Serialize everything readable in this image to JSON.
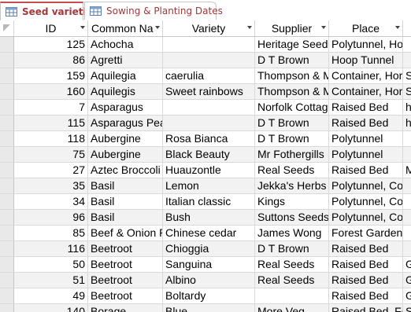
{
  "tabs": [
    {
      "label": "Seed varieties",
      "active": true
    },
    {
      "label": "Sowing & Planting Dates",
      "active": false
    }
  ],
  "columns": [
    "ID",
    "Common Na",
    "Variety",
    "Supplier",
    "Place",
    ""
  ],
  "rows": [
    [
      "125",
      "Achocha",
      "",
      "Heritage Seed",
      "Polytunnel, Ho",
      ""
    ],
    [
      "86",
      "Agretti",
      "",
      "D T Brown",
      "Hoop Tunnel",
      ""
    ],
    [
      "159",
      "Aquilegia",
      "caerulia",
      "Thompson & M",
      "Container, Hor",
      "S"
    ],
    [
      "160",
      "Aquilegis",
      "Sweet rainbows",
      "Thompson & M",
      "Container, Hor",
      "S"
    ],
    [
      "7",
      "Asparagus",
      "",
      "Norfolk Cottag",
      "Raised Bed",
      "h"
    ],
    [
      "115",
      "Asparagus Pea",
      "",
      "D T Brown",
      "Raised Bed",
      "h"
    ],
    [
      "118",
      "Aubergine",
      "Rosa Bianca",
      "D T Brown",
      "Polytunnel",
      ""
    ],
    [
      "75",
      "Aubergine",
      "Black Beauty",
      "Mr Fothergills",
      "Polytunnel",
      ""
    ],
    [
      "27",
      "Aztec Broccoli",
      "Huauzontle",
      "Real Seeds",
      "Raised Bed",
      "M"
    ],
    [
      "35",
      "Basil",
      "Lemon",
      "Jekka's Herbs",
      "Polytunnel, Co",
      ""
    ],
    [
      "34",
      "Basil",
      "Italian classic",
      "Kings",
      "Polytunnel, Co",
      ""
    ],
    [
      "96",
      "Basil",
      "Bush",
      "Suttons Seeds",
      "Polytunnel, Co",
      ""
    ],
    [
      "85",
      "Beef & Onion P",
      "Chinese cedar",
      "James Wong",
      "Forest Garden",
      ""
    ],
    [
      "116",
      "Beetroot",
      "Chioggia",
      "D T Brown",
      "Raised Bed",
      ""
    ],
    [
      "50",
      "Beetroot",
      "Sanguina",
      "Real Seeds",
      "Raised Bed",
      "G"
    ],
    [
      "51",
      "Beetroot",
      "Albino",
      "Real Seeds",
      "Raised Bed",
      "G"
    ],
    [
      "49",
      "Beetroot",
      "Boltardy",
      "",
      "Raised Bed",
      "G"
    ],
    [
      "140",
      "Borage",
      "Blue",
      "More Veg",
      "Raised Bed, Fo",
      "S"
    ]
  ],
  "icons": {
    "tab": "table-icon",
    "sort": "dropdown-arrow-icon",
    "select_all": "select-all-icon"
  },
  "colors": {
    "tab_text": "#a4373a",
    "active_tab_border": "#c0504d",
    "alt_row": "#f2f2f2"
  }
}
